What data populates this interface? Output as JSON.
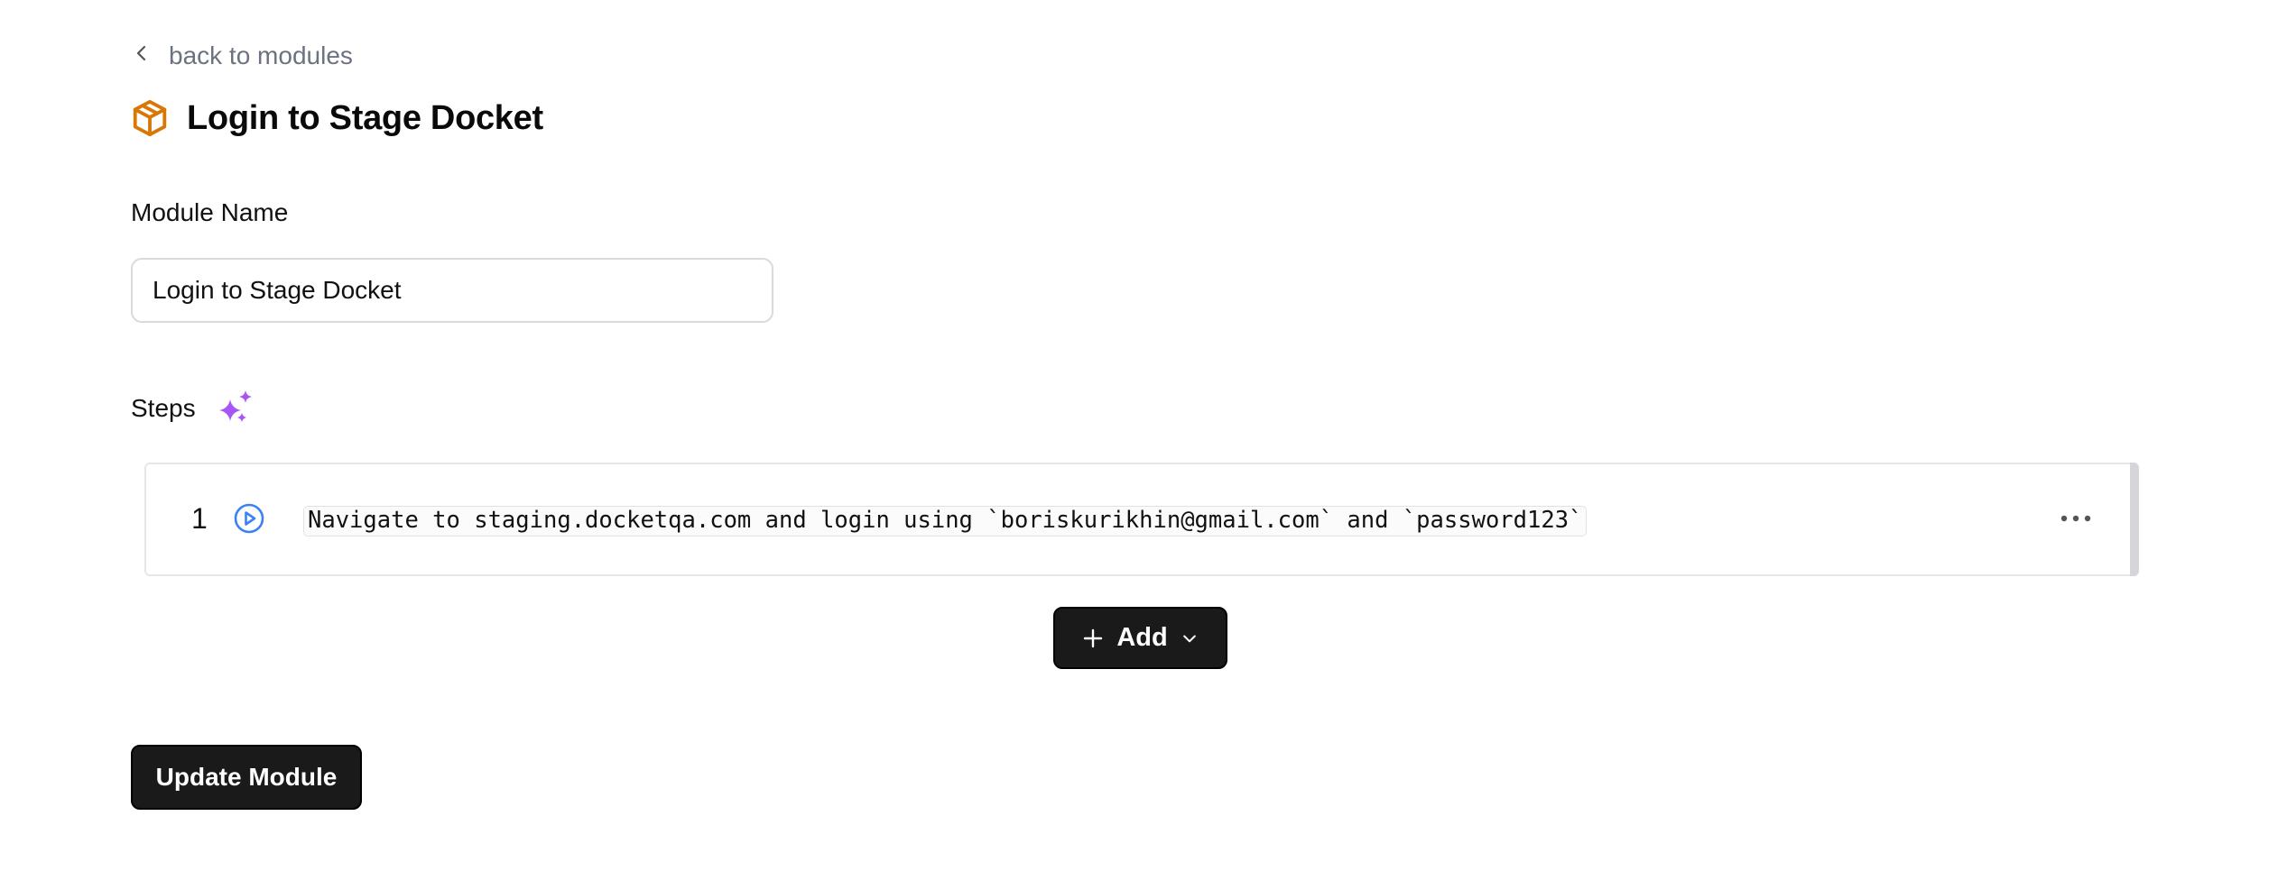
{
  "nav": {
    "back_label": "back to modules",
    "back_icon": "chevron-left-icon"
  },
  "header": {
    "title": "Login to Stage Docket",
    "icon": "package-icon",
    "icon_color": "#d97706"
  },
  "form": {
    "module_name_label": "Module Name",
    "module_name_value": "Login to Stage Docket"
  },
  "steps": {
    "label": "Steps",
    "ai_icon": "sparkles-icon",
    "ai_icon_color": "#a855f7",
    "items": [
      {
        "number": "1",
        "run_icon": "play-circle-icon",
        "run_icon_color": "#3b82f6",
        "text": "Navigate to staging.docketqa.com and login using `boriskurikhin@gmail.com` and `password123`",
        "menu_icon": "more-horizontal-icon"
      }
    ]
  },
  "actions": {
    "add_label": "Add",
    "add_icon": "plus-icon",
    "add_dropdown_icon": "chevron-down-icon",
    "update_label": "Update Module"
  }
}
